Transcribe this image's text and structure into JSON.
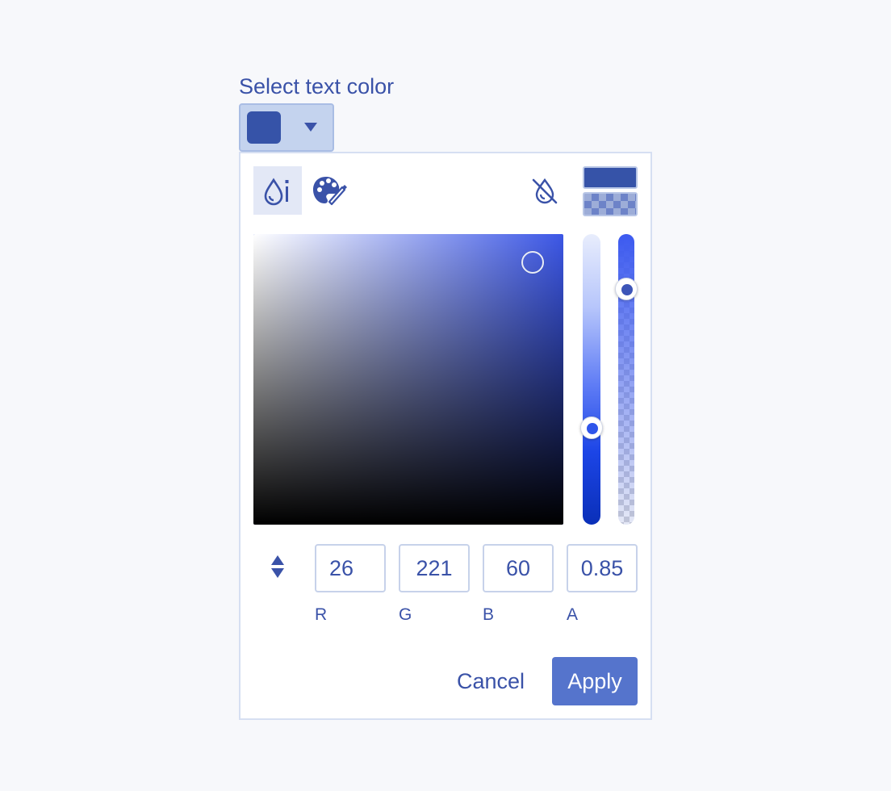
{
  "label": "Select text color",
  "colors": {
    "accent": "#3a52a8",
    "selected_swatch": "#3653a8",
    "sv_hue": "#3c57e6",
    "apply_bg": "#5574cc"
  },
  "trigger": {
    "icon": "chevron-down-icon"
  },
  "toolbar": {
    "tools": [
      {
        "icon": "color-drop-picker-icon",
        "active": true
      },
      {
        "icon": "palette-brush-icon",
        "active": false
      },
      {
        "icon": "no-color-drop-icon",
        "active": false
      }
    ]
  },
  "sliders": {
    "hue_level": 0.68,
    "alpha_level": 0.85
  },
  "fields": [
    {
      "value": "26",
      "label": "R"
    },
    {
      "value": "221",
      "label": "G"
    },
    {
      "value": "60",
      "label": "B"
    },
    {
      "value": "0.85",
      "label": "A"
    }
  ],
  "mode_toggle": {
    "icon": "up-down-toggle-icon"
  },
  "actions": {
    "cancel": "Cancel",
    "apply": "Apply"
  }
}
